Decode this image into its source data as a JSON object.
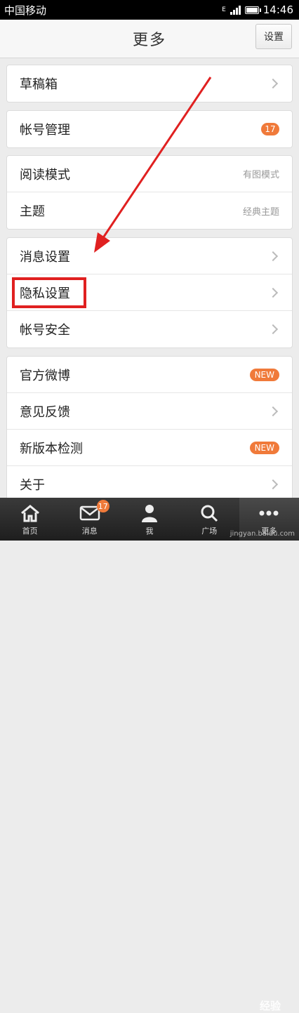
{
  "status_bar": {
    "carrier": "中国移动",
    "time": "14:46",
    "network": "E"
  },
  "header": {
    "title": "更多",
    "settings_label": "设置"
  },
  "groups": [
    {
      "items": [
        {
          "label": "草稿箱"
        }
      ]
    },
    {
      "items": [
        {
          "label": "帐号管理",
          "badge": "17"
        }
      ]
    },
    {
      "items": [
        {
          "label": "阅读模式",
          "value": "有图模式"
        },
        {
          "label": "主题",
          "value": "经典主题"
        }
      ]
    },
    {
      "items": [
        {
          "label": "消息设置"
        },
        {
          "label": "隐私设置"
        },
        {
          "label": "帐号安全"
        }
      ]
    },
    {
      "items": [
        {
          "label": "官方微博",
          "badge": "NEW"
        },
        {
          "label": "意见反馈"
        },
        {
          "label": "新版本检测",
          "badge": "NEW"
        },
        {
          "label": "关于"
        }
      ]
    }
  ],
  "tabbar": {
    "tabs": [
      {
        "label": "首页",
        "icon": "home-icon"
      },
      {
        "label": "消息",
        "icon": "mail-icon",
        "badge": "17"
      },
      {
        "label": "我",
        "icon": "person-icon"
      },
      {
        "label": "广场",
        "icon": "search-icon"
      },
      {
        "label": "更多",
        "icon": "more-icon"
      }
    ]
  },
  "watermark": {
    "logo": "经验",
    "url": "jingyan.baidu.com"
  },
  "colors": {
    "accent": "#f07a3a",
    "annotation": "#e02020"
  }
}
